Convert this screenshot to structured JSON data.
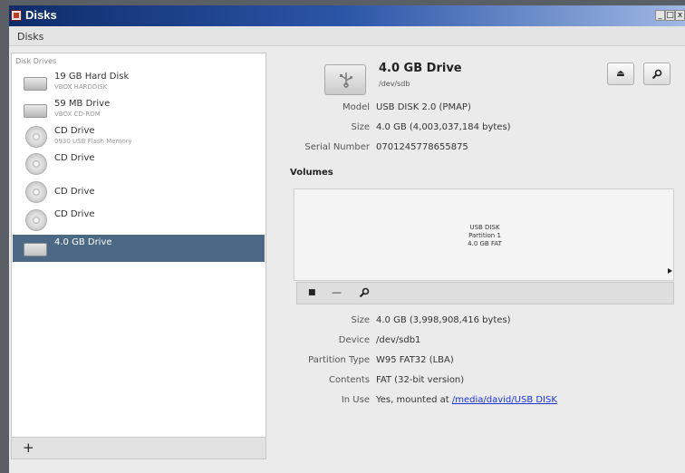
{
  "window": {
    "title": "Disks",
    "controls": {
      "minimize": "_",
      "maximize": "□",
      "close": "x"
    }
  },
  "menu": {
    "disks": "Disks"
  },
  "sidebar": {
    "heading": "Disk Drives",
    "drives": [
      {
        "name": "19 GB Hard Disk",
        "subtitle": "VBOX HARDDISK",
        "icon": "hard-disk-icon"
      },
      {
        "name": "59 MB Drive",
        "subtitle": "VBOX CD-ROM",
        "icon": "hard-disk-icon"
      },
      {
        "name": "CD Drive",
        "subtitle": "0930 USB Flash Memory",
        "icon": "optical-disc-icon"
      },
      {
        "name": "CD Drive",
        "icon": "optical-disc-icon"
      },
      {
        "name": "CD Drive",
        "icon": "optical-disc-icon"
      },
      {
        "name": "CD Drive",
        "icon": "optical-disc-icon"
      },
      {
        "name": "4.0 GB Drive",
        "icon": "usb-drive-icon",
        "selected": true
      }
    ],
    "add_button": "+"
  },
  "disk": {
    "title": "4.0 GB Drive",
    "device": "/dev/sdb",
    "eject_icon": "⏏",
    "settings_icon": "wrench-icon",
    "model_label": "Model",
    "model": "USB DISK 2.0 (PMAP)",
    "size_label": "Size",
    "size": "4.0 GB (4,003,037,184 bytes)",
    "serial_label": "Serial Number",
    "serial": "0701245778655875"
  },
  "volumes": {
    "title": "Volumes",
    "partition": {
      "line1": "USB DISK",
      "line2": "Partition 1",
      "line3": "4.0 GB FAT"
    },
    "toolbar": {
      "stop": "■",
      "remove": "—",
      "settings_icon": "wrench-icon"
    },
    "details": {
      "size_label": "Size",
      "size": "4.0 GB (3,998,908,416 bytes)",
      "device_label": "Device",
      "device": "/dev/sdb1",
      "partition_type_label": "Partition Type",
      "partition_type": "W95 FAT32 (LBA)",
      "contents_label": "Contents",
      "contents": "FAT (32-bit version)",
      "in_use_label": "In Use",
      "in_use_prefix": "Yes, mounted at",
      "mount_point": "/media/david/USB DISK"
    }
  },
  "colors": {
    "selection": "#4b6884",
    "title_bar_start": "#0e2c6a",
    "title_bar_end": "#9fb8e4",
    "link": "#1a35d6"
  }
}
